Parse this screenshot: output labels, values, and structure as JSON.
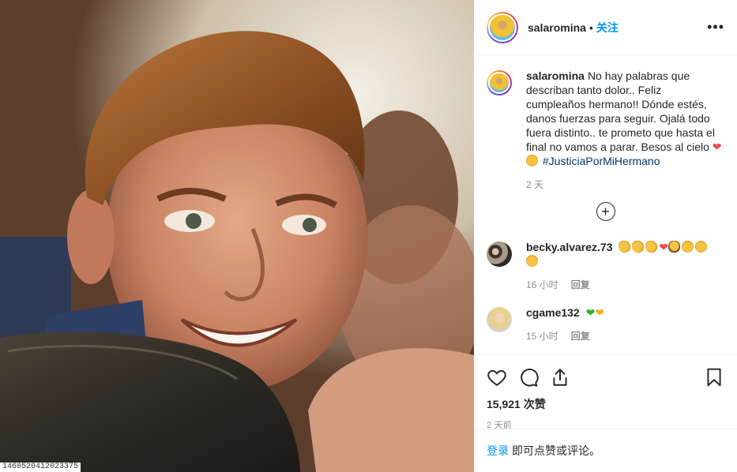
{
  "photo": {
    "caption_id": "1460520412023375"
  },
  "header": {
    "username": "salaromina",
    "separator": "•",
    "follow_label": "关注",
    "more_icon": "more-horizontal-icon"
  },
  "caption": {
    "username": "salaromina",
    "text": "No hay palabras que describan tanto dolor.. Feliz cumpleaños hermano!! Dónde estés, danos fuerzas para seguir. Ojalá todo fuera distinto.. te prometo que hasta el final no vamos a parar. Besos al cielo",
    "hashtag": "#JusticiaPorMiHermano",
    "time": "2 天"
  },
  "comments": [
    {
      "username": "becky.alvarez.73",
      "time": "16 小时",
      "reply_label": "回复"
    },
    {
      "username": "cgame132",
      "time": "15 小时",
      "reply_label": "回复"
    }
  ],
  "actions": {
    "like_icon": "heart-icon",
    "comment_icon": "comment-icon",
    "share_icon": "share-icon",
    "save_icon": "bookmark-icon"
  },
  "stats": {
    "likes": "15,921 次赞",
    "date": "2 天前"
  },
  "login": {
    "link": "登录",
    "text": "即可点赞或评论。"
  },
  "colors": {
    "link_blue": "#0095f6",
    "hashtag_blue": "#00376b",
    "heart_red": "#ed4956",
    "meta_gray": "#8e8e8e"
  }
}
